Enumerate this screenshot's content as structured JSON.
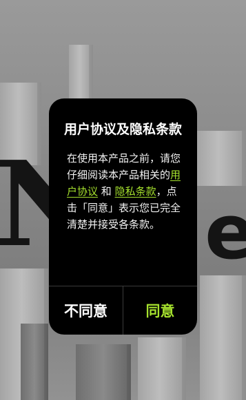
{
  "background": {
    "logo_text": "Nie",
    "logo_main": "N",
    "logo_tail": "e"
  },
  "dialog": {
    "title": "用户协议及隐私条款",
    "body": {
      "part1": "在使用本产品之前，请您仔细阅读本产品相关的",
      "user_agreement_link": "用户协议",
      "and": " 和 ",
      "privacy_link": "隐私条款",
      "part2": "，点击「同意」表示您已完全清楚并接受各条款。"
    },
    "disagree_label": "不同意",
    "agree_label": "同意"
  },
  "colors": {
    "accent": "#a6e22e",
    "dialog_bg": "#000000",
    "text": "#ffffff"
  }
}
